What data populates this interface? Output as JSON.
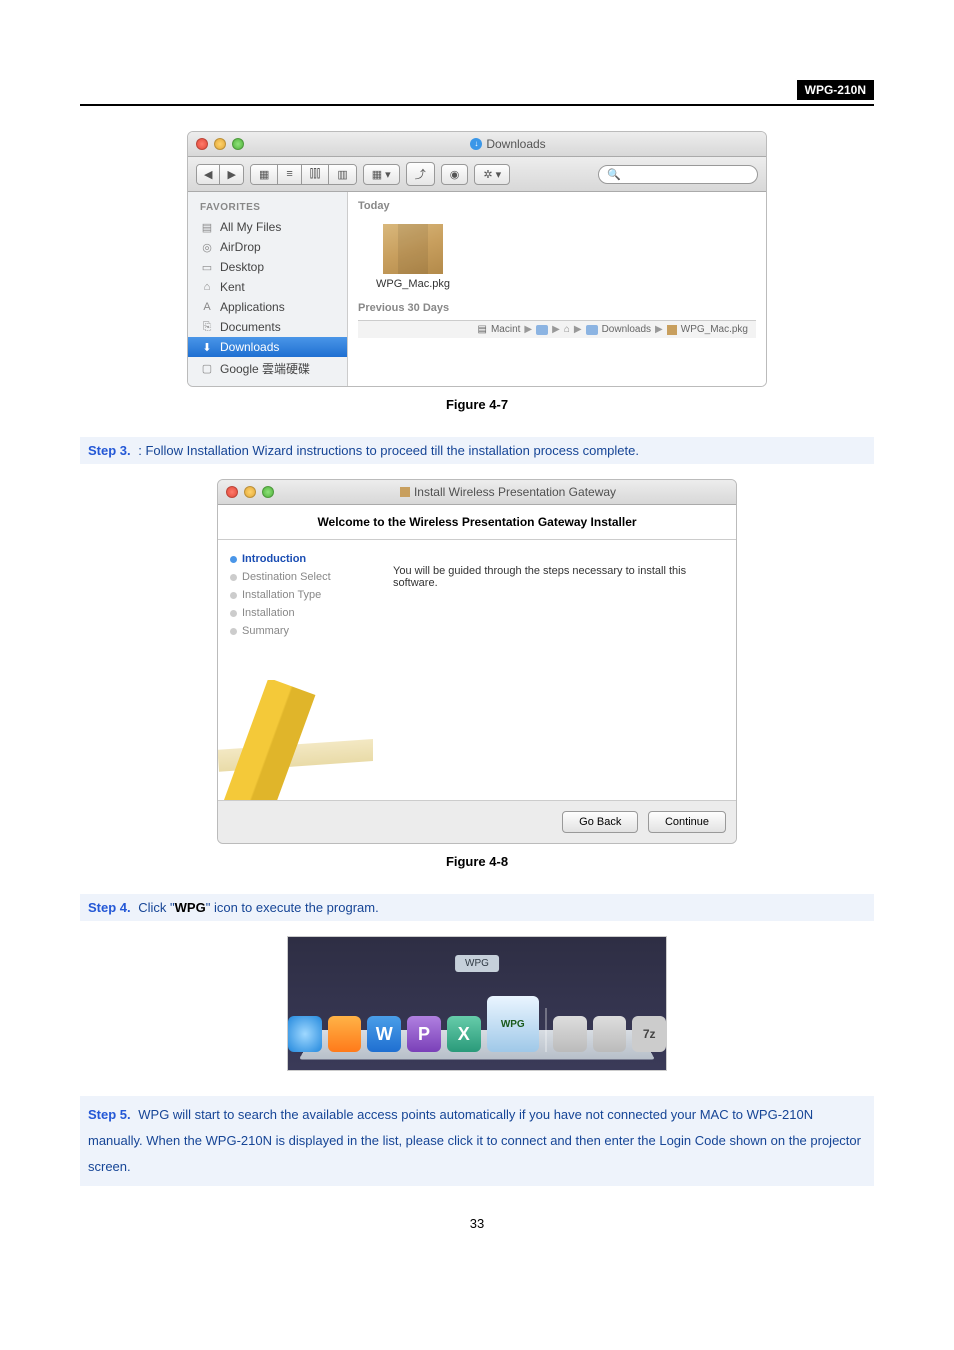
{
  "header": {
    "product": "WPG-210N"
  },
  "figure1": {
    "caption": "Figure 4-7",
    "window_title": "Downloads",
    "search_placeholder": "",
    "sidebar": {
      "heading": "FAVORITES",
      "items": [
        {
          "label": "All My Files"
        },
        {
          "label": "AirDrop"
        },
        {
          "label": "Desktop"
        },
        {
          "label": "Kent"
        },
        {
          "label": "Applications"
        },
        {
          "label": "Documents"
        },
        {
          "label": "Downloads",
          "selected": true
        },
        {
          "label": "Google 雲端硬碟"
        }
      ]
    },
    "section_today": "Today",
    "file_name": "WPG_Mac.pkg",
    "section_prev": "Previous 30 Days",
    "pathbar": [
      "Macint",
      "Downloads",
      "WPG_Mac.pkg"
    ]
  },
  "step3": {
    "label": "Step 3.",
    "text": ": Follow Installation Wizard instructions to proceed till the installation process complete."
  },
  "figure2": {
    "caption": "Figure 4-8",
    "window_title": "Install Wireless Presentation Gateway",
    "subtitle": "Welcome to the Wireless Presentation Gateway Installer",
    "nav": [
      {
        "label": "Introduction",
        "active": true
      },
      {
        "label": "Destination Select"
      },
      {
        "label": "Installation Type"
      },
      {
        "label": "Installation"
      },
      {
        "label": "Summary"
      }
    ],
    "body_text": "You will be guided through the steps necessary to install this software.",
    "btn_back": "Go Back",
    "btn_continue": "Continue"
  },
  "step4": {
    "label": "Step 4.",
    "prefix": "Click \"",
    "bold": "WPG",
    "suffix": "\" icon to execute the program."
  },
  "dock": {
    "tooltip": "WPG",
    "wpg_label": "WPG",
    "seven_z": "7z"
  },
  "step5": {
    "label": "Step 5.",
    "text": "WPG will start to search the available access points automatically if you have not connected your MAC to WPG-210N manually. When the WPG-210N is displayed in the list, please click it to connect and then enter the Login Code shown on the projector screen."
  },
  "page_number": "33"
}
